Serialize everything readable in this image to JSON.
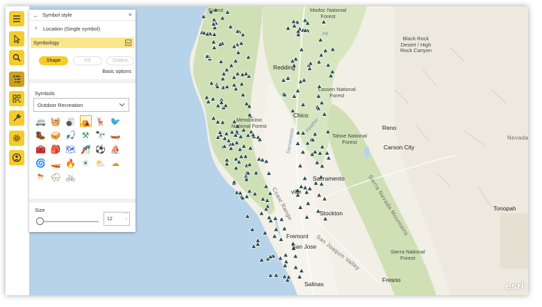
{
  "panel": {
    "title": "Symbol style",
    "layer_name": "Location (Single symbol)",
    "symbology_label": "Symbology",
    "tabs": [
      {
        "label": "Shape",
        "active": true
      },
      {
        "label": "Fill",
        "active": false
      },
      {
        "label": "Outline",
        "active": false
      }
    ],
    "basic_options_label": "Basic options",
    "symbols_label": "Symbols",
    "symbol_set": "Outdoor Recreation",
    "symbols": [
      {
        "icon": "camper-icon"
      },
      {
        "icon": "picnic-icon"
      },
      {
        "icon": "bowling-icon"
      },
      {
        "icon": "tent-icon",
        "selected": true
      },
      {
        "icon": "deer-icon"
      },
      {
        "icon": "bird-icon"
      },
      {
        "icon": "hiking-boot-icon"
      },
      {
        "icon": "sandwich-icon"
      },
      {
        "icon": "fishing-icon"
      },
      {
        "icon": "crossed-tools-icon"
      },
      {
        "icon": "binoculars-icon"
      },
      {
        "icon": "canoe-icon"
      },
      {
        "icon": "treasure-chest-icon"
      },
      {
        "icon": "backpack-icon"
      },
      {
        "icon": "map-icon"
      },
      {
        "icon": "waterslide-icon"
      },
      {
        "icon": "soccer-icon"
      },
      {
        "icon": "boat-icon"
      },
      {
        "icon": "windy-icon"
      },
      {
        "icon": "boat-small-icon"
      },
      {
        "icon": "fire-icon"
      },
      {
        "icon": "sun-icon"
      },
      {
        "icon": "partly-sunny-icon"
      },
      {
        "icon": "cloud-icon"
      },
      {
        "icon": "thunderstorm-icon"
      },
      {
        "icon": "snowy-cloud-icon"
      },
      {
        "icon": "bicycle-icon"
      }
    ],
    "size_label": "Size",
    "size_value": "12",
    "size_fraction": 0.0
  },
  "toolbar": {
    "buttons": [
      {
        "icon": "hamburger-menu-icon",
        "active": false
      },
      {
        "icon": "cursor-select-icon",
        "active": false
      },
      {
        "icon": "search-icon",
        "active": false
      },
      {
        "icon": "layers-list-icon",
        "active": true
      },
      {
        "icon": "qr-grid-icon",
        "active": false
      },
      {
        "icon": "wrench-icon",
        "active": false
      },
      {
        "icon": "gear-icon",
        "active": false
      },
      {
        "icon": "user-icon",
        "active": false
      }
    ]
  },
  "map": {
    "labels": {
      "forest_top": "Forest",
      "modoc": "Modoc National\nForest",
      "black_rock": "Black Rock\nDesert / High\nRock Canyon",
      "pit": "Pit",
      "redding": "Redding",
      "lassen": "Lassen National\nForest",
      "chico": "Chico",
      "mendocino": "Mendocino\nNational Forest",
      "tahoe": "Tahoe National\nForest",
      "reno": "Reno",
      "carson_city": "Carson City",
      "nevada": "Nevada",
      "sacramento_river": "Sacramento",
      "feather": "Feather",
      "sacramento": "Sacramento",
      "sierra_nevada": "Sierra Nevada Mountains",
      "coast_range": "Coast Range",
      "tonopah": "Tonopah",
      "stockton": "Stockton",
      "san_joaquin": "San Joaquin Valley",
      "fremont": "Fremont",
      "san_jose": "San Jose",
      "sierra_forest": "Sierra National\nForest",
      "fresno": "Fresno",
      "salinas": "Salinas",
      "ville": "ville"
    },
    "attribution": "esri",
    "marker_color": "#2f4f4f"
  },
  "colors": {
    "accent": "#f5cc2a",
    "accent_light": "#fbe68c",
    "ocean": "#b7d3ea",
    "forest": "#cfe0b5",
    "land": "#f2efe6"
  }
}
